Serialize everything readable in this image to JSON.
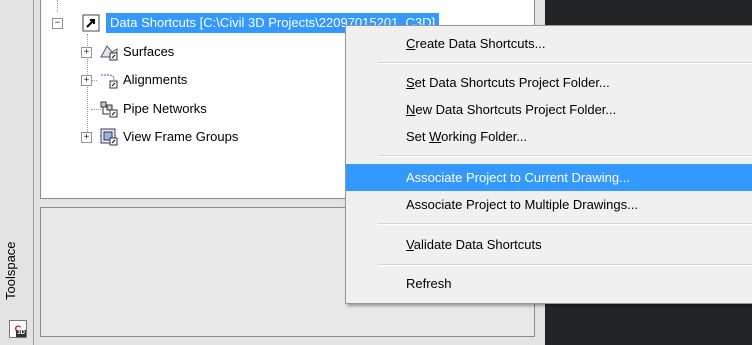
{
  "toolspace": {
    "label": "Toolspace"
  },
  "tree": {
    "root": {
      "label": "Data Shortcuts [C:\\Civil 3D Projects\\22097015201_C3D]"
    },
    "items": [
      {
        "label": "Surfaces",
        "icon": "surface-icon"
      },
      {
        "label": "Alignments",
        "icon": "alignment-icon"
      },
      {
        "label": "Pipe Networks",
        "icon": "pipe-network-icon"
      },
      {
        "label": "View Frame Groups",
        "icon": "view-frame-group-icon"
      }
    ]
  },
  "context_menu": {
    "items": [
      {
        "label": "Create Data Shortcuts...",
        "mnemonic_index": 0,
        "highlighted": false
      },
      {
        "label": "Set Data Shortcuts Project Folder...",
        "mnemonic_index": 0,
        "highlighted": false
      },
      {
        "label": "New Data Shortcuts Project Folder...",
        "mnemonic_index": 0,
        "highlighted": false
      },
      {
        "label": "Set Working Folder...",
        "mnemonic_index": 4,
        "highlighted": false
      },
      {
        "label": "Associate Project to Current Drawing...",
        "mnemonic_index": -1,
        "highlighted": true
      },
      {
        "label": "Associate Project to Multiple Drawings...",
        "mnemonic_index": -1,
        "highlighted": false
      },
      {
        "label": "Validate Data Shortcuts",
        "mnemonic_index": 0,
        "highlighted": false
      },
      {
        "label": "Refresh",
        "mnemonic_index": -1,
        "highlighted": false
      }
    ]
  },
  "colors": {
    "highlight": "#3399ff",
    "panel_bg": "#e3e3e3",
    "dark_bg": "#222427"
  }
}
